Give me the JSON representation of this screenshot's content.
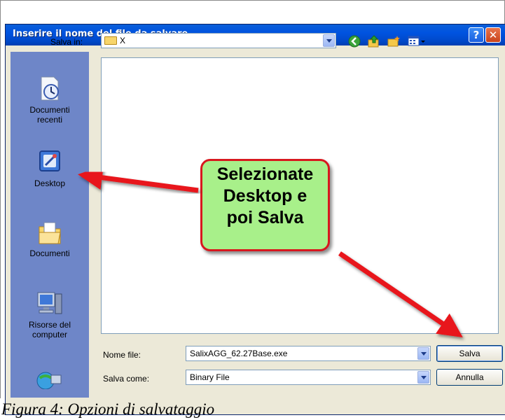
{
  "dialog": {
    "title": "Inserire il nome del file da salvare...",
    "help_glyph": "?",
    "close_glyph": "✕"
  },
  "toolbar": {
    "save_in_label": "Salva in:",
    "save_in_value": "X",
    "nav_icons": [
      "back-icon",
      "up-folder-icon",
      "new-folder-icon",
      "views-menu-icon"
    ]
  },
  "places": [
    {
      "label_line1": "Documenti",
      "label_line2": "recenti",
      "icon": "recent-documents-icon"
    },
    {
      "label_line1": "Desktop",
      "label_line2": "",
      "icon": "desktop-icon"
    },
    {
      "label_line1": "Documenti",
      "label_line2": "",
      "icon": "my-documents-icon"
    },
    {
      "label_line1": "Risorse del",
      "label_line2": "computer",
      "icon": "my-computer-icon"
    },
    {
      "label_line1": "",
      "label_line2": "",
      "icon": "network-places-icon"
    }
  ],
  "form": {
    "file_name_label": "Nome file:",
    "file_name_value": "SalixAGG_62.27Base.exe",
    "save_as_label": "Salva come:",
    "save_as_value": "Binary File"
  },
  "buttons": {
    "save": "Salva",
    "cancel": "Annulla"
  },
  "callout": {
    "line1": "Selezionate",
    "line2": "Desktop e",
    "line3": "poi Salva"
  },
  "caption": "Figura 4: Opzioni di salvataggio",
  "colors": {
    "title_bar": "#0053e0",
    "places_bar": "#6e86c8",
    "dialog_bg": "#ece9d8",
    "callout_fill": "#a8f08a",
    "callout_border": "#d8181e",
    "arrow": "#e8141a"
  }
}
